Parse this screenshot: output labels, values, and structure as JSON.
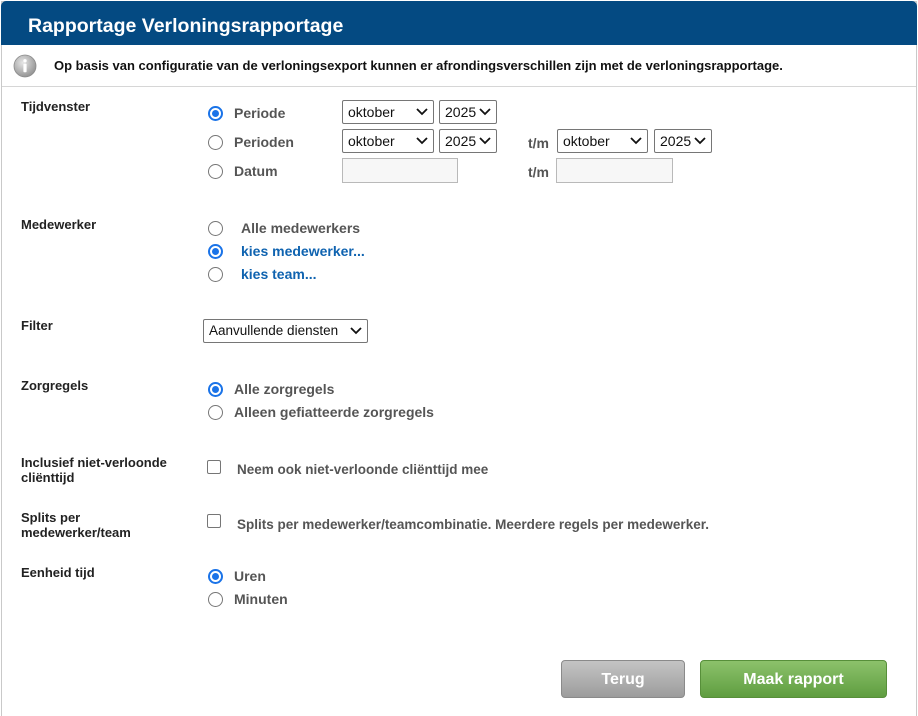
{
  "window": {
    "title": "Rapportage Verloningsrapportage"
  },
  "info": {
    "message": "Op basis van configuratie van de verloningsexport kunnen er afrondingsverschillen zijn met de verloningsrapportage."
  },
  "tijdvenster": {
    "label": "Tijdvenster",
    "periode_label": "Periode",
    "periode_month": "oktober",
    "periode_year": "2025",
    "perioden_label": "Perioden",
    "perioden_from_month": "oktober",
    "perioden_from_year": "2025",
    "tm": "t/m",
    "perioden_to_month": "oktober",
    "perioden_to_year": "2025",
    "datum_label": "Datum",
    "datum_from": "",
    "datum_to": "",
    "selected": "Periode"
  },
  "medewerker": {
    "label": "Medewerker",
    "alle": "Alle medewerkers",
    "kies_medewerker": "kies medewerker...",
    "kies_team": "kies team...",
    "selected": "kies medewerker..."
  },
  "filter": {
    "label": "Filter",
    "value": "Aanvullende diensten"
  },
  "zorgregels": {
    "label": "Zorgregels",
    "alle": "Alle zorgregels",
    "gefiatteerd": "Alleen gefiatteerde zorgregels",
    "selected": "Alle zorgregels"
  },
  "inclusief": {
    "label_line1": "Inclusief niet-verloonde",
    "label_line2": "cliënttijd",
    "checkbox_text": "Neem ook niet-verloonde cliënttijd mee",
    "checked": false
  },
  "splits": {
    "label_line1": "Splits per",
    "label_line2": "medewerker/team",
    "checkbox_text": "Splits per medewerker/teamcombinatie. Meerdere regels per medewerker.",
    "checked": false
  },
  "eenheid": {
    "label": "Eenheid tijd",
    "uren": "Uren",
    "minuten": "Minuten",
    "selected": "Uren"
  },
  "buttons": {
    "back": "Terug",
    "make": "Maak rapport"
  },
  "colors": {
    "titlebar": "#044a82",
    "accent": "#1a73e8",
    "link": "#0f63b0",
    "make_button": "#6aa84f",
    "back_button": "#b0b0b0"
  },
  "icons": {
    "info": "info-icon",
    "dropdown": "chevron-down-icon"
  }
}
